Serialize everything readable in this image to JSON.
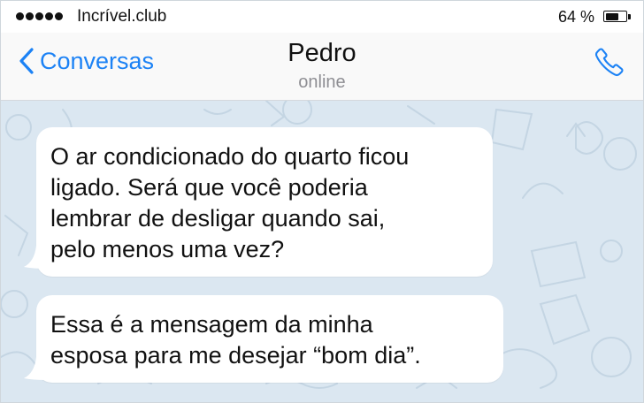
{
  "status_bar": {
    "carrier": "Incrível.club",
    "battery_percent": "64 %",
    "battery_level": 0.64,
    "signal_bars": 5
  },
  "nav": {
    "back_label": "Conversas",
    "contact_name": "Pedro",
    "status": "online",
    "accent_color": "#1c82f5"
  },
  "messages": [
    {
      "lines": [
        "O ar condicionado do quarto ficou",
        "ligado. Será que você poderia",
        "lembrar de desligar quando sai,",
        "pelo menos uma vez?"
      ]
    },
    {
      "lines": [
        "Essa é a mensagem da minha",
        "esposa para me desejar “bom dia”."
      ]
    }
  ]
}
